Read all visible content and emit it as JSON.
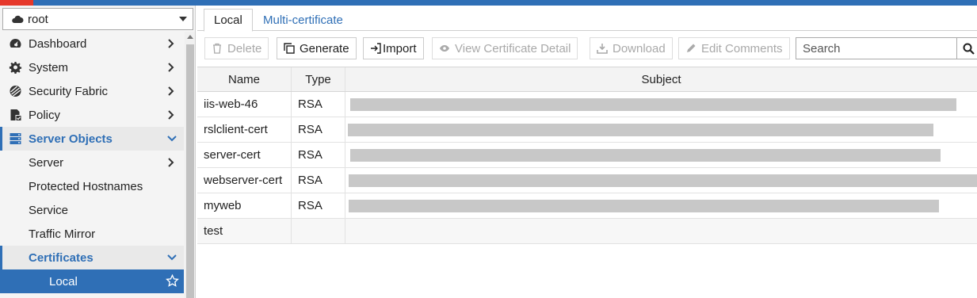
{
  "vdom": {
    "value": "root",
    "icon": "cloud-icon"
  },
  "menu": {
    "dashboard": "Dashboard",
    "system": "System",
    "security_fabric": "Security Fabric",
    "policy": "Policy",
    "server_objects": "Server Objects",
    "server": "Server",
    "protected_hostnames": "Protected Hostnames",
    "service": "Service",
    "traffic_mirror": "Traffic Mirror",
    "certificates": "Certificates",
    "local": "Local"
  },
  "tabs": {
    "local": "Local",
    "multi": "Multi-certificate"
  },
  "toolbar": {
    "delete": "Delete",
    "generate": "Generate",
    "import": "Import",
    "view_detail": "View Certificate Detail",
    "download": "Download",
    "edit_comments": "Edit Comments",
    "search_placeholder": "Search"
  },
  "table": {
    "headers": {
      "name": "Name",
      "type": "Type",
      "subject": "Subject"
    },
    "rows": [
      {
        "name": "iis-web-46",
        "type": "RSA"
      },
      {
        "name": "rslclient-cert",
        "type": "RSA"
      },
      {
        "name": "server-cert",
        "type": "RSA"
      },
      {
        "name": "webserver-cert",
        "type": "RSA"
      },
      {
        "name": "myweb",
        "type": "RSA"
      },
      {
        "name": "test",
        "type": ""
      }
    ]
  },
  "colors": {
    "accent": "#2f6fb6",
    "topbar_red": "#e6382b",
    "redaction": "#c8c8c8"
  }
}
